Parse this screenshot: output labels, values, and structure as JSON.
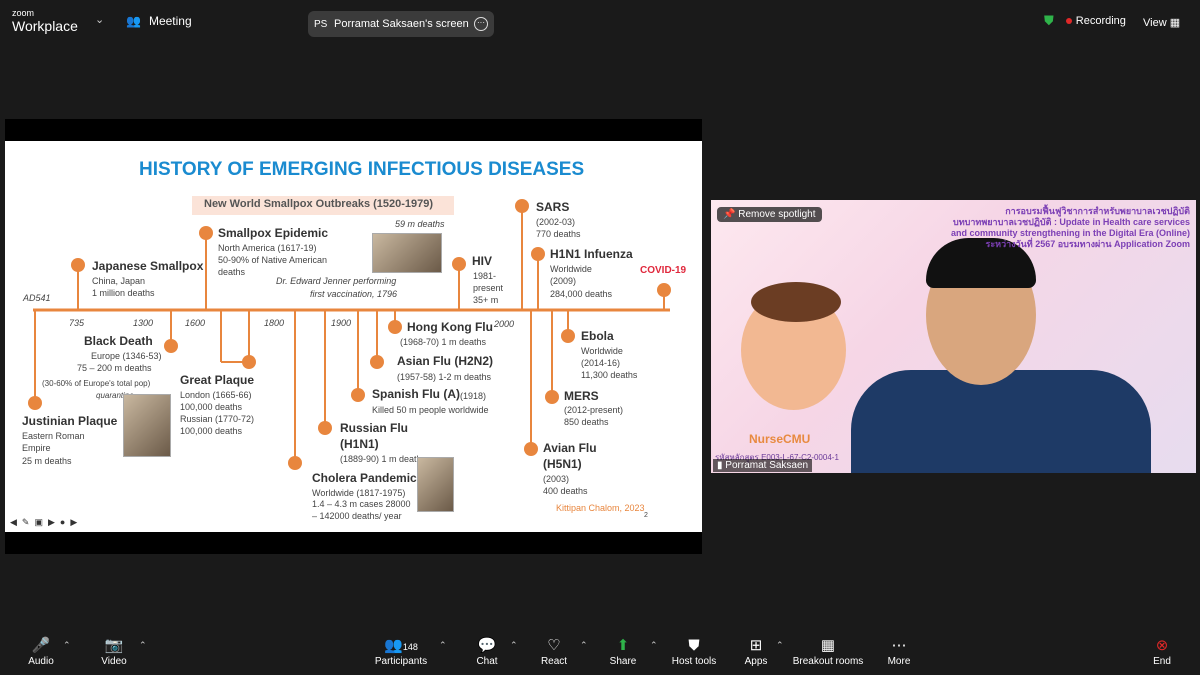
{
  "app": {
    "brand_top": "zoom",
    "brand_bottom": "Workplace",
    "meeting_label": "Meeting",
    "share_initials": "PS",
    "share_label": "Porramat Saksaen's screen",
    "recording": "Recording",
    "view": "View"
  },
  "slide": {
    "title": "HISTORY OF EMERGING INFECTIOUS DISEASES",
    "band": "New World Smallpox Outbreaks (1520-1979)",
    "years": [
      "AD541",
      "735",
      "1300",
      "1600",
      "1800",
      "1900",
      "2000"
    ],
    "events": {
      "justinian": {
        "name": "Justinian Plaque",
        "l1": "Eastern Roman",
        "l2": "Empire",
        "l3": "25 m deaths"
      },
      "japanese": {
        "name": "Japanese Smallpox",
        "l1": "China, Japan",
        "l2": "1 million deaths"
      },
      "black": {
        "name": "Black Death",
        "l1": "Europe (1346-53)",
        "l2": "75 – 200 m deaths",
        "l3": "(30-60% of Europe's total pop)",
        "l4": "quarantine"
      },
      "great": {
        "name": "Great Plaque",
        "l1": "London (1665-66)",
        "l2": "100,000 deaths",
        "l3": "Russian (1770-72)",
        "l4": "100,000 deaths"
      },
      "smallpox": {
        "name": "Smallpox Epidemic",
        "l1": "North America (1617-19)",
        "l2": "50-90% of Native American",
        "l3": "deaths"
      },
      "jenner": {
        "l1": "59 m deaths",
        "l2": "Dr. Edward Jenner performing",
        "l3": "first vaccination, 1796"
      },
      "russian": {
        "name": "Russian Flu",
        "name2": "(H1N1)",
        "l1": "(1889-90) 1 m deaths"
      },
      "cholera": {
        "name": "Cholera Pandemic",
        "l1": "Worldwide (1817-1975)",
        "l2": "1.4 – 4.3 m cases 28000",
        "l3": "– 142000 deaths/ year"
      },
      "spanish": {
        "name": "Spanish Flu (A)",
        "year": "(1918)",
        "l1": "Killed 50 m people worldwide"
      },
      "asian": {
        "name": "Asian Flu (H2N2)",
        "l1": "(1957-58) 1-2 m deaths"
      },
      "hongkong": {
        "name": "Hong Kong Flu",
        "l1": "(1968-70) 1 m deaths"
      },
      "hiv": {
        "name": "HIV",
        "l1": "1981-",
        "l2": "present",
        "l3": "35+ m"
      },
      "sars": {
        "name": "SARS",
        "l1": "(2002-03)",
        "l2": "770 deaths"
      },
      "h1n1": {
        "name": "H1N1 Infuenza",
        "l1": "Worldwide",
        "l2": "(2009)",
        "l3": "284,000 deaths"
      },
      "covid": {
        "name": "COVID-19"
      },
      "ebola": {
        "name": "Ebola",
        "l1": "Worldwide",
        "l2": "(2014-16)",
        "l3": "11,300 deaths"
      },
      "mers": {
        "name": "MERS",
        "l1": "(2012-present)",
        "l2": "850 deaths"
      },
      "avian": {
        "name": "Avian Flu",
        "name2": "(H5N1)",
        "l1": "(2003)",
        "l2": "400 deaths"
      }
    },
    "credit": "Kittipan Chalom, 2023",
    "page": "2"
  },
  "video": {
    "spotlight": "Remove spotlight",
    "overlay_lines": [
      "การอบรมฟื้นฟูวิชาการสำหรับพยาบาลเวชปฏิบัติ",
      "บทบาทพยาบาลเวชปฏิบัติ : Update in Health care services",
      "and community strengthening in the Digital Era (Online)",
      "ระหว่างวันที่ 2567 อบรมทางผ่าน Application Zoom"
    ],
    "mascot": "NurseCMU",
    "code": "รหัสหลักสูตร E003-L-67-C2-0004-1",
    "name": "Porramat Saksaen"
  },
  "toolbar": {
    "audio": "Audio",
    "video": "Video",
    "participants": "Participants",
    "participants_count": "148",
    "chat": "Chat",
    "react": "React",
    "share": "Share",
    "host": "Host tools",
    "apps": "Apps",
    "breakout": "Breakout rooms",
    "more": "More",
    "end": "End"
  }
}
